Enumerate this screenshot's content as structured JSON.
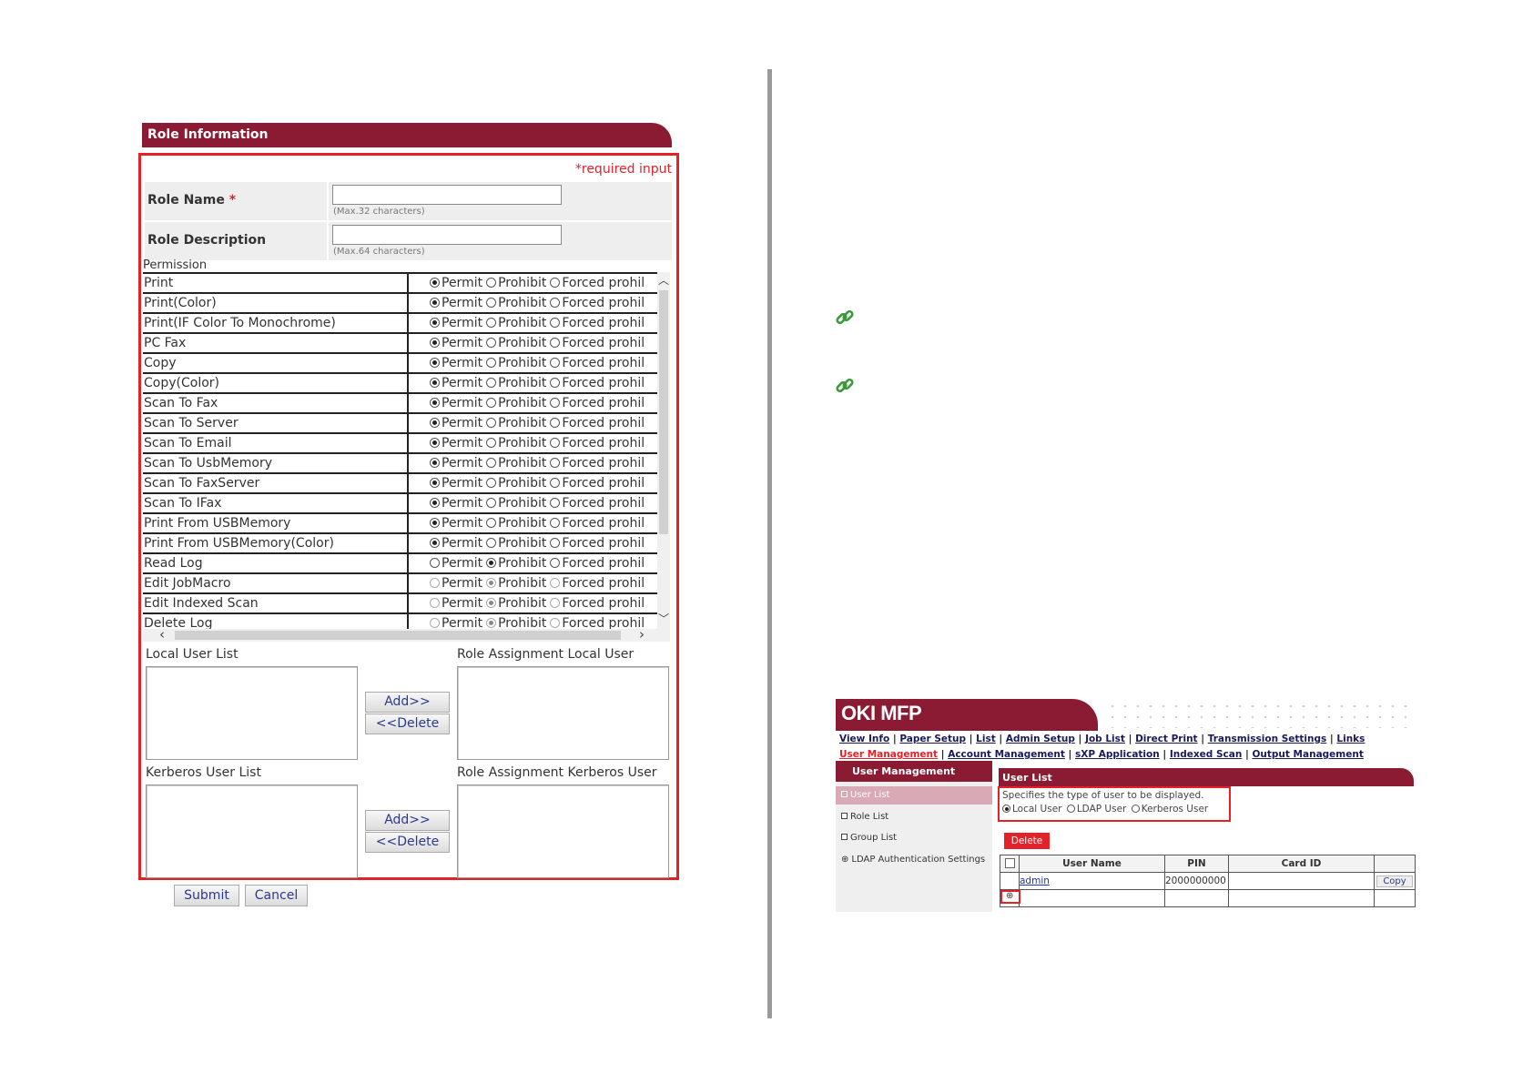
{
  "role_info": {
    "header": "Role Information",
    "required_note": "*required input",
    "role_name": {
      "label": "Role Name",
      "star": "*",
      "value": "",
      "hint": "(Max.32 characters)"
    },
    "role_description": {
      "label": "Role Description",
      "value": "",
      "hint": "(Max.64 characters)"
    },
    "permission_title": "Permission",
    "option_labels": [
      "Permit",
      "Prohibit",
      "Forced prohil"
    ],
    "permissions": [
      {
        "name": "Print",
        "selected": 0,
        "enabled": true
      },
      {
        "name": "Print(Color)",
        "selected": 0,
        "enabled": true
      },
      {
        "name": "Print(IF Color To Monochrome)",
        "selected": 0,
        "enabled": true
      },
      {
        "name": "PC Fax",
        "selected": 0,
        "enabled": true
      },
      {
        "name": "Copy",
        "selected": 0,
        "enabled": true
      },
      {
        "name": "Copy(Color)",
        "selected": 0,
        "enabled": true
      },
      {
        "name": "Scan To Fax",
        "selected": 0,
        "enabled": true
      },
      {
        "name": "Scan To Server",
        "selected": 0,
        "enabled": true
      },
      {
        "name": "Scan To Email",
        "selected": 0,
        "enabled": true
      },
      {
        "name": "Scan To UsbMemory",
        "selected": 0,
        "enabled": true
      },
      {
        "name": "Scan To FaxServer",
        "selected": 0,
        "enabled": true
      },
      {
        "name": "Scan To IFax",
        "selected": 0,
        "enabled": true
      },
      {
        "name": "Print From USBMemory",
        "selected": 0,
        "enabled": true
      },
      {
        "name": "Print From USBMemory(Color)",
        "selected": 0,
        "enabled": true
      },
      {
        "name": "Read Log",
        "selected": 1,
        "enabled": true
      },
      {
        "name": "Edit JobMacro",
        "selected": 1,
        "enabled": false
      },
      {
        "name": "Edit Indexed Scan",
        "selected": 1,
        "enabled": false
      },
      {
        "name": "Delete Log",
        "selected": 1,
        "enabled": false
      }
    ],
    "local_user_list_label": "Local User List",
    "role_assignment_local_label": "Role Assignment Local User",
    "kerberos_user_list_label": "Kerberos User List",
    "role_assignment_kerberos_label": "Role Assignment Kerberos User",
    "add_label": "Add>>",
    "delete_label": "<<Delete",
    "submit_label": "Submit",
    "cancel_label": "Cancel"
  },
  "oki_mfp": {
    "title": "OKI MFP",
    "nav_row1": [
      "View Info",
      "Paper Setup",
      "List",
      "Admin Setup",
      "Job List",
      "Direct Print",
      "Transmission Settings",
      "Links"
    ],
    "nav_row2": [
      "User Management",
      "Account Management",
      "sXP Application",
      "Indexed Scan",
      "Output Management"
    ],
    "sidebar_header": "User Management",
    "sidebar_items": [
      "User List",
      "Role List",
      "Group List",
      "LDAP Authentication Settings"
    ],
    "user_list_header": "User List",
    "filter_text": "Specifies the type of user to be displayed.",
    "filter_options": [
      "Local User",
      "LDAP User",
      "Kerberos User"
    ],
    "delete_label": "Delete",
    "table_headers": [
      "User Name",
      "PIN",
      "Card ID"
    ],
    "rows": [
      {
        "user": "admin",
        "pin": "2000000000",
        "card": "",
        "action": "Copy"
      }
    ],
    "add_symbol": "⊕"
  },
  "colors": {
    "brand": "#8a1b32",
    "highlight": "#e42128",
    "link_icon": "#3a9a3a"
  }
}
